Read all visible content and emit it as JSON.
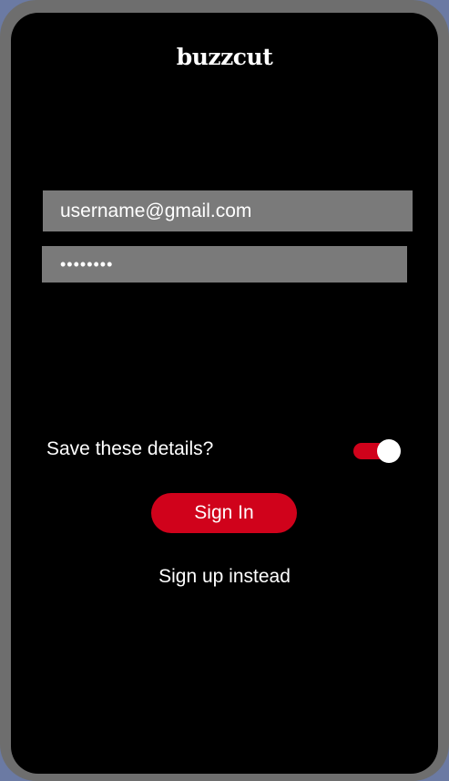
{
  "app": {
    "brand": "buzzcut"
  },
  "login": {
    "email_value": "username@gmail.com",
    "password_value": "••••••••"
  },
  "save_details": {
    "label": "Save these details?",
    "toggle_on": true
  },
  "actions": {
    "signin_label": "Sign In",
    "signup_label": "Sign up instead"
  },
  "colors": {
    "accent": "#d0021b",
    "field_bg": "#7a7a7a",
    "screen_bg": "#000000",
    "frame": "#6e6e6e"
  }
}
